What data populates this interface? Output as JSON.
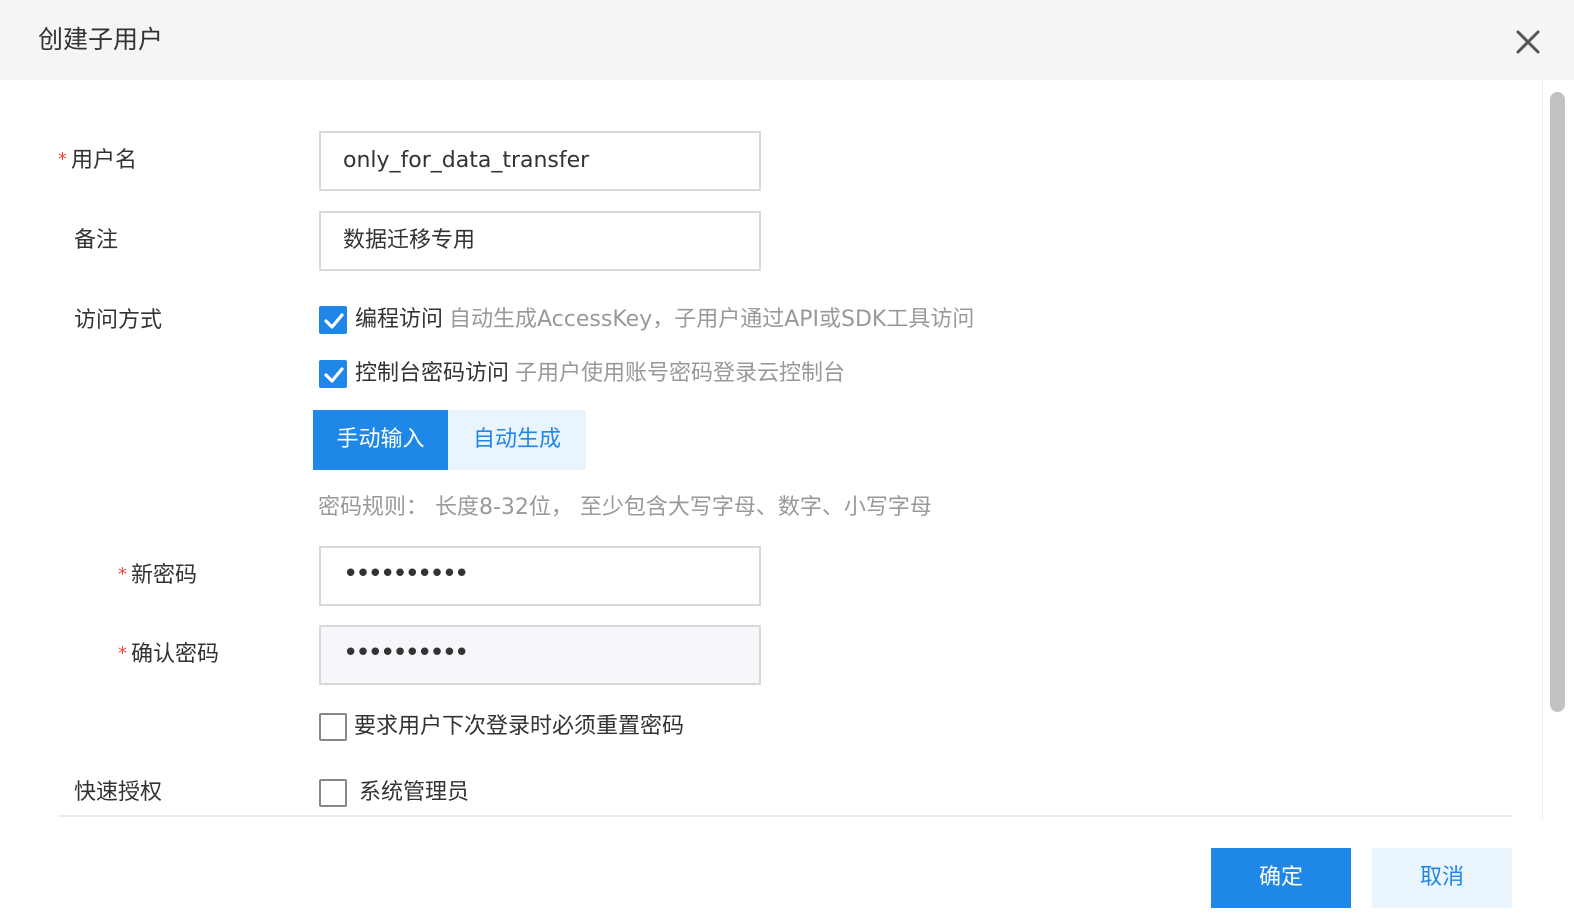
{
  "dialog": {
    "title": "创建子用户"
  },
  "form": {
    "username": {
      "label": "用户名",
      "required_mark": "*",
      "value": "only_for_data_transfer"
    },
    "remark": {
      "label": "备注",
      "value": "数据迁移专用"
    },
    "access": {
      "label": "访问方式",
      "programmatic": {
        "label": "编程访问",
        "hint": "自动生成AccessKey，子用户通过API或SDK工具访问",
        "checked": true
      },
      "console": {
        "label": "控制台密码访问",
        "hint": "子用户使用账号密码登录云控制台",
        "checked": true
      }
    },
    "password_tabs": [
      {
        "label": "手动输入",
        "active": true
      },
      {
        "label": "自动生成",
        "active": false
      }
    ],
    "password_rule": "密码规则： 长度8-32位， 至少包含大写字母、数字、小写字母",
    "new_password": {
      "label": "新密码",
      "required_mark": "*",
      "value": "••••••••••"
    },
    "confirm_password": {
      "label": "确认密码",
      "required_mark": "*",
      "value": "••••••••••"
    },
    "reset_on_login": {
      "label": "要求用户下次登录时必须重置密码",
      "checked": false
    },
    "quick_auth": {
      "label": "快速授权",
      "admin": {
        "label": "系统管理员",
        "checked": false
      }
    }
  },
  "footer": {
    "ok_label": "确定",
    "cancel_label": "取消"
  },
  "colors": {
    "primary": "#1f87e8",
    "primary_light": "#eaf4fd",
    "required": "#e84a3c",
    "hint": "#999999",
    "header_bg": "#f4f5f7"
  },
  "icons": {
    "close": "close-icon",
    "check": "check-icon"
  }
}
